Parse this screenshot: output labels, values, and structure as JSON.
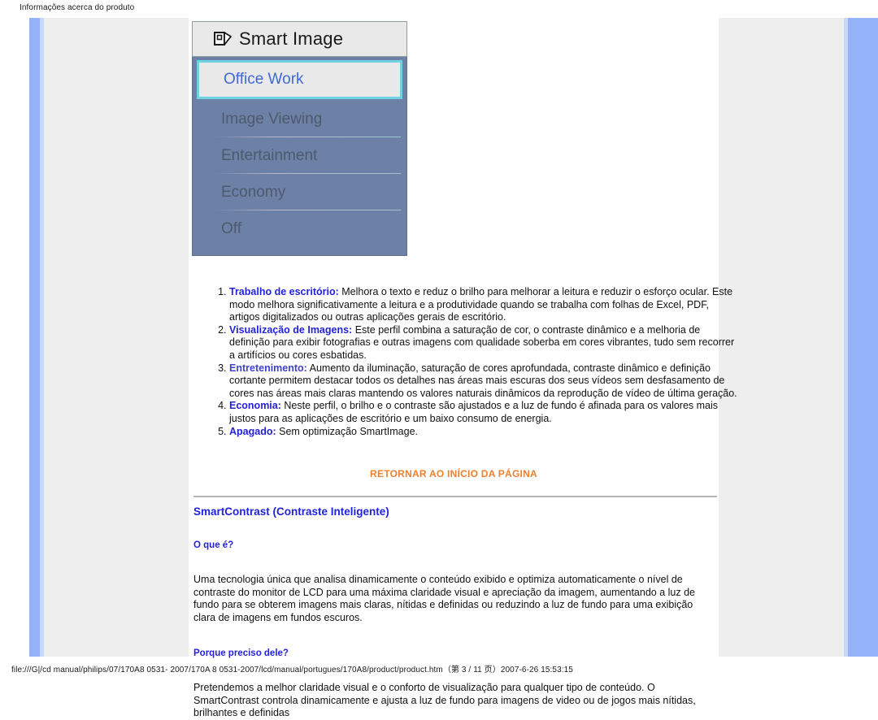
{
  "print": {
    "header": "Informações acerca do produto",
    "footer": "file:///G|/cd manual/philips/07/170A8 0531- 2007/170A 8 0531-2007/lcd/manual/portugues/170A8/product/product.htm（第 3 / 11 页）2007-6-26 15:53:15"
  },
  "osd": {
    "title": "Smart Image",
    "icon": "smartimage-icon",
    "items": [
      {
        "label": "Office Work",
        "selected": true
      },
      {
        "label": "Image Viewing",
        "selected": false
      },
      {
        "label": "Entertainment",
        "selected": false
      },
      {
        "label": "Economy",
        "selected": false
      },
      {
        "label": "Off",
        "selected": false
      }
    ]
  },
  "modes": [
    {
      "label": "Trabalho de escritório:",
      "text": " Melhora o texto e reduz o brilho para melhorar a leitura e reduzir o esforço ocular. Este modo melhora significativamente a leitura e a produtividade quando se trabalha com folhas de Excel, PDF, artigos digitalizados ou outras aplicações gerais de escritório."
    },
    {
      "label": "Visualização de Imagens:",
      "text": " Este perfil combina a saturação de cor, o contraste dinâmico e a melhoria de definição para exibir fotografias e outras imagens com qualidade soberba em cores vibrantes, tudo sem recorrer a artifícios ou cores esbatidas."
    },
    {
      "label": "Entretenimento:",
      "text": " Aumento da iluminação, saturação de cores aprofundada, contraste dinâmico e definição cortante permitem destacar todos os detalhes nas áreas mais escuras dos seus vídeos sem desfasamento de cores nas áreas mais claras mantendo os valores naturais dinâmicos da reprodução de vídeo de última geração."
    },
    {
      "label": "Economia:",
      "text": " Neste perfil, o brilho e o contraste são ajustados e a luz de fundo é afinada para os valores mais justos para as aplicações de escritório e um baixo consumo de energia."
    },
    {
      "label": "Apagado:",
      "text": " Sem optimização SmartImage."
    }
  ],
  "return_top": {
    "label": "RETORNAR AO INÍCIO DA PÁGINA",
    "color": "#f08030"
  },
  "smartcontrast": {
    "heading": "SmartContrast (Contraste Inteligente)",
    "q1_heading": "O que é?",
    "q1_body": "Uma tecnologia única que analisa dinamicamente o conteúdo exibido e optimiza automaticamente o nível de contraste do monitor de LCD para uma máxima claridade visual e apreciação da imagem, aumentando a luz de fundo para se obterem imagens mais claras, nítidas e definidas ou reduzindo a luz de fundo para uma exibição clara de imagens em fundos escuros.",
    "q2_heading": "Porque preciso dele?",
    "q2_body": "Pretendemos a melhor claridade visual e o conforto de visualização para qualquer tipo de conteúdo. O SmartContrast controla dinamicamente e ajusta a luz de fundo para imagens de video ou de jogos mais nítidas, brilhantes e definidas"
  },
  "colors": {
    "frame_blue": "#93b2f7",
    "frame_light_blue": "#c7d8fb",
    "panel_grey": "#eeeeee",
    "heading_blue": "#2222dd",
    "link_orange": "#f08030",
    "osd_body": "#6d81a7",
    "osd_selected_border": "#6fd2e0",
    "osd_selected_text": "#4169d6"
  }
}
